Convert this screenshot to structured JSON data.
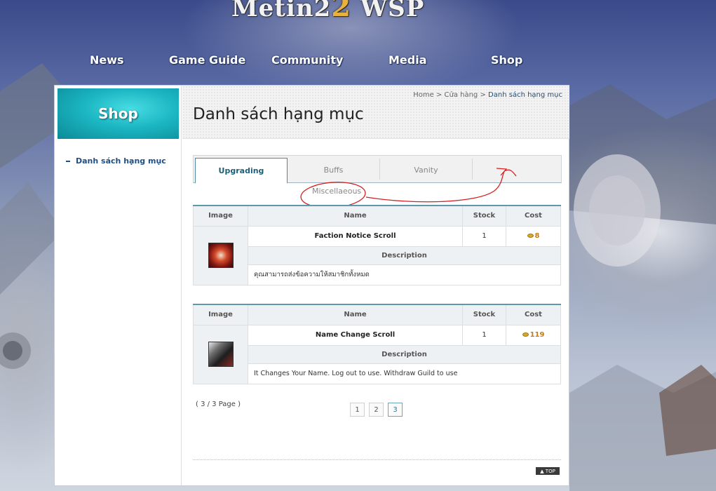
{
  "site": {
    "logo_text": "Metin2",
    "logo_number": "2",
    "logo_suffix": "WSP"
  },
  "nav": [
    {
      "label": "News"
    },
    {
      "label": "Game Guide"
    },
    {
      "label": "Community"
    },
    {
      "label": "Media"
    },
    {
      "label": "Shop"
    }
  ],
  "sidebar": {
    "banner": "Shop",
    "link": "Danh sách hạng mục"
  },
  "header": {
    "breadcrumb": {
      "home": "Home",
      "sep1": ">",
      "shop": "Cửa hàng",
      "sep2": ">",
      "current": "Danh sách hạng mục"
    },
    "title": "Danh sách hạng mục"
  },
  "tabs": [
    {
      "label": "Upgrading",
      "active": true
    },
    {
      "label": "Buffs",
      "active": false
    },
    {
      "label": "Vanity",
      "active": false
    },
    {
      "label": "Miscellaeous",
      "active": false
    }
  ],
  "table_headers": {
    "image": "Image",
    "name": "Name",
    "stock": "Stock",
    "cost": "Cost",
    "description": "Description"
  },
  "items": [
    {
      "name": "Faction Notice Scroll",
      "stock": "1",
      "cost": "8",
      "description": "คุณสามารถส่งข้อความให้สมาชิกทั้งหมด",
      "icon": "faction-scroll-icon"
    },
    {
      "name": "Name Change Scroll",
      "stock": "1",
      "cost": "119",
      "description": "It Changes Your Name. Log out to use. Withdraw Guild to use",
      "icon": "name-change-scroll-icon"
    }
  ],
  "pagination": {
    "info": "( 3 / 3 Page )",
    "pages": [
      "1",
      "2",
      "3"
    ],
    "current": "3"
  },
  "top_button": "▲ TOP",
  "colors": {
    "accent": "#1d5f78",
    "annotation": "#d42020",
    "cost": "#c97a12"
  }
}
